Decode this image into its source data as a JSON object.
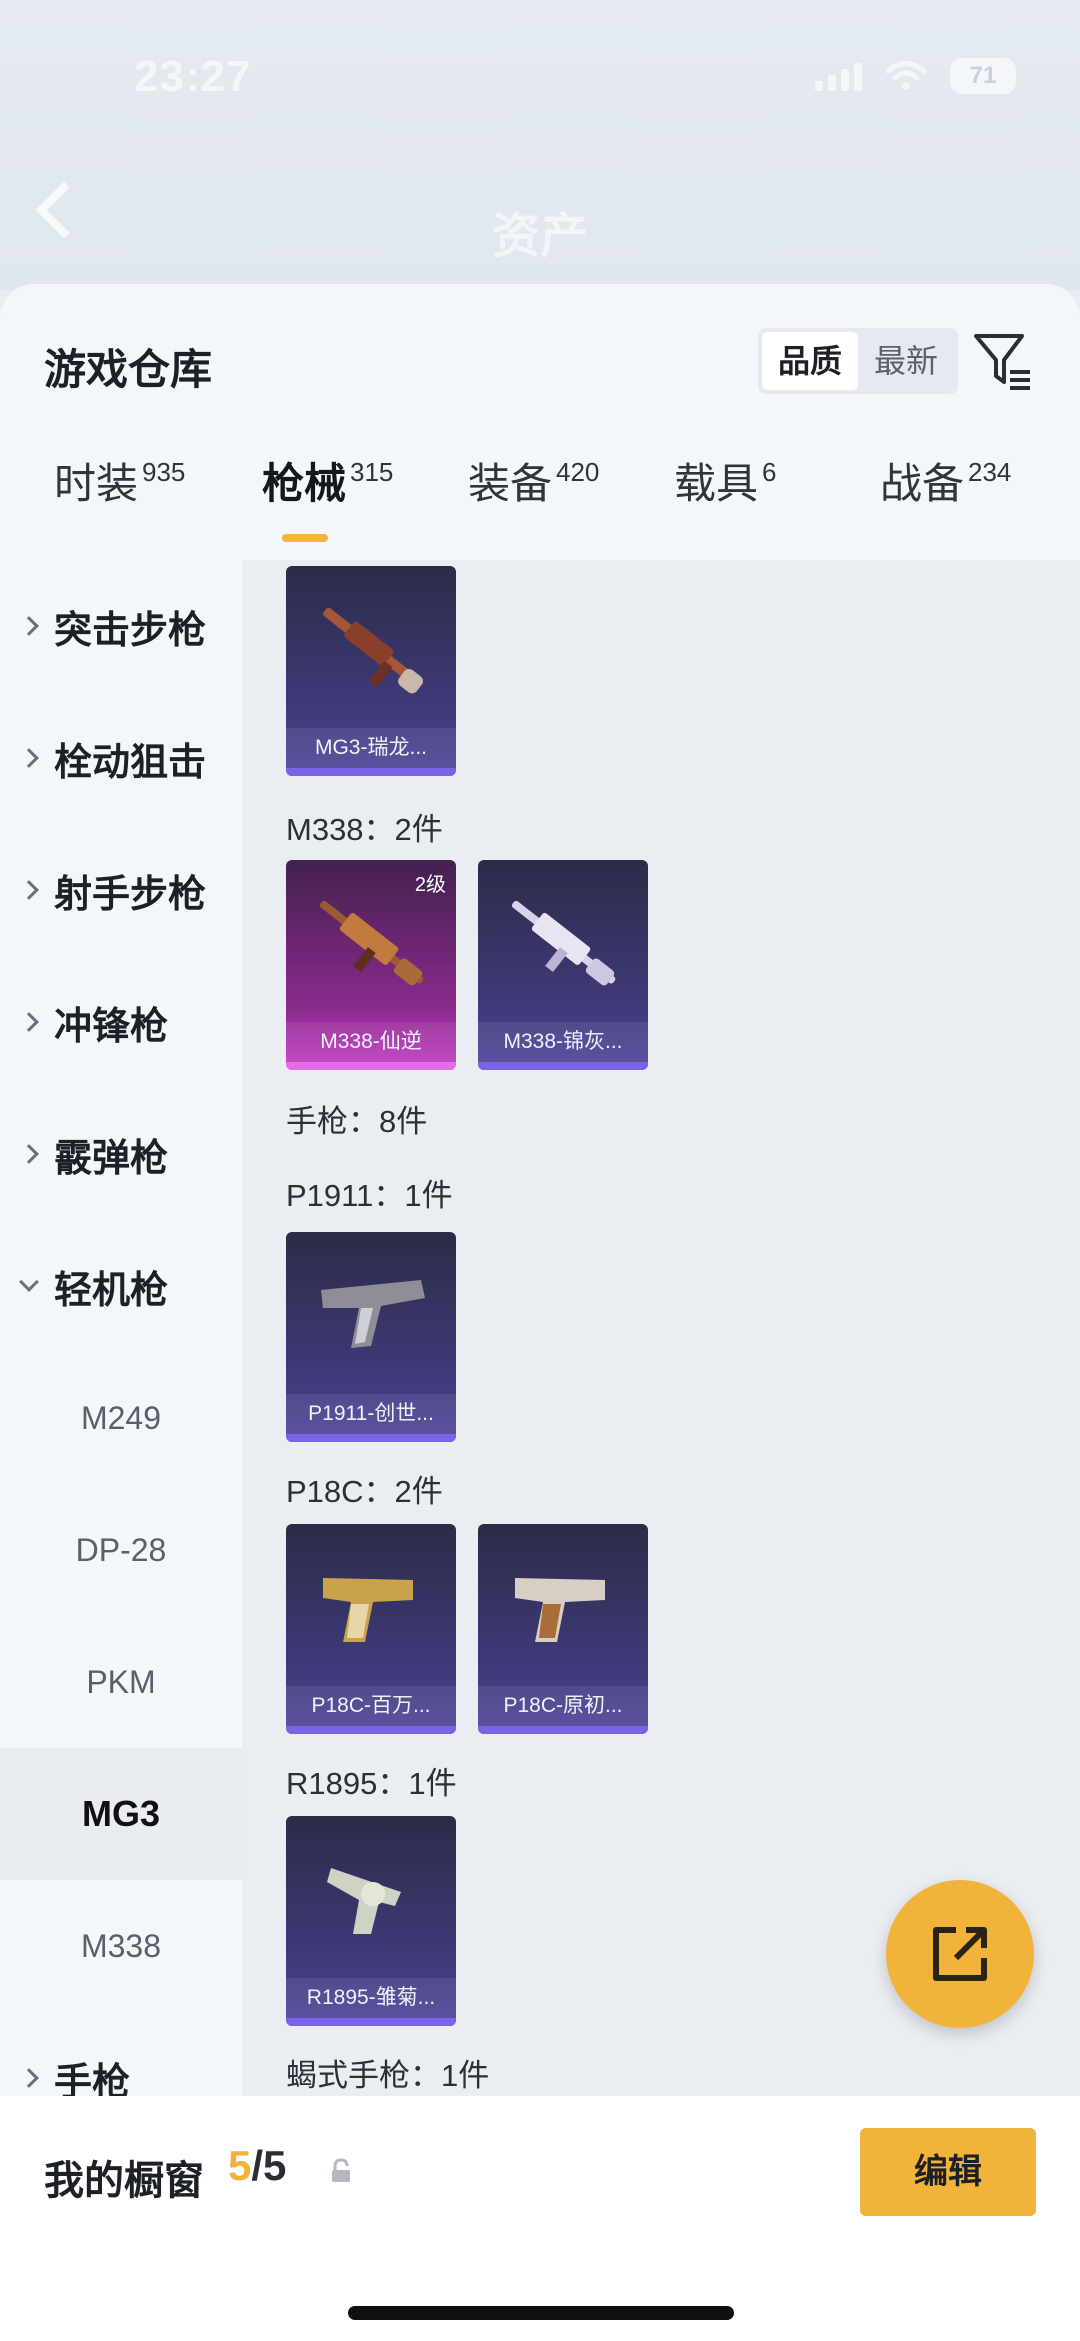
{
  "status": {
    "time": "23:27",
    "battery": "71"
  },
  "header": {
    "title": "资产"
  },
  "warehouse": {
    "title": "游戏仓库",
    "sort_options": [
      "品质",
      "最新"
    ],
    "filter_icon": "filter-icon",
    "tabs": [
      {
        "label": "时装",
        "count": "935"
      },
      {
        "label": "枪械",
        "count": "315"
      },
      {
        "label": "装备",
        "count": "420"
      },
      {
        "label": "载具",
        "count": "6"
      },
      {
        "label": "战备",
        "count": "234"
      }
    ],
    "active_tab": "枪械"
  },
  "sidebar": {
    "categories": [
      "突击步枪",
      "栓动狙击",
      "射手步枪",
      "冲锋枪",
      "霰弹枪",
      "轻机枪"
    ],
    "sub_items": [
      "M249",
      "DP-28",
      "PKM",
      "MG3",
      "M338"
    ],
    "active_sub": "MG3",
    "last_category": "手枪"
  },
  "content": {
    "items": [
      {
        "name": "MG3-瑞龙...",
        "level": ""
      },
      {
        "name": "M338-仙逆",
        "level": "2级"
      },
      {
        "name": "M338-锦灰...",
        "level": ""
      },
      {
        "name": "P1911-创世...",
        "level": ""
      },
      {
        "name": "P18C-百万...",
        "level": ""
      },
      {
        "name": "P18C-原初...",
        "level": ""
      },
      {
        "name": "R1895-雏菊...",
        "level": ""
      }
    ],
    "labels": {
      "m338": "M338：2件",
      "pistol": "手枪：8件",
      "p1911": "P1911：1件",
      "p18c": "P18C：2件",
      "r1895": "R1895：1件",
      "scorpion": "蝎式手枪：1件"
    }
  },
  "bottom": {
    "title": "我的橱窗",
    "current": "5",
    "total": "/5",
    "edit_label": "编辑"
  },
  "colors": {
    "accent": "#f2b33a",
    "card_purple": "#403a7b",
    "card_pink": "#c43bc4"
  }
}
